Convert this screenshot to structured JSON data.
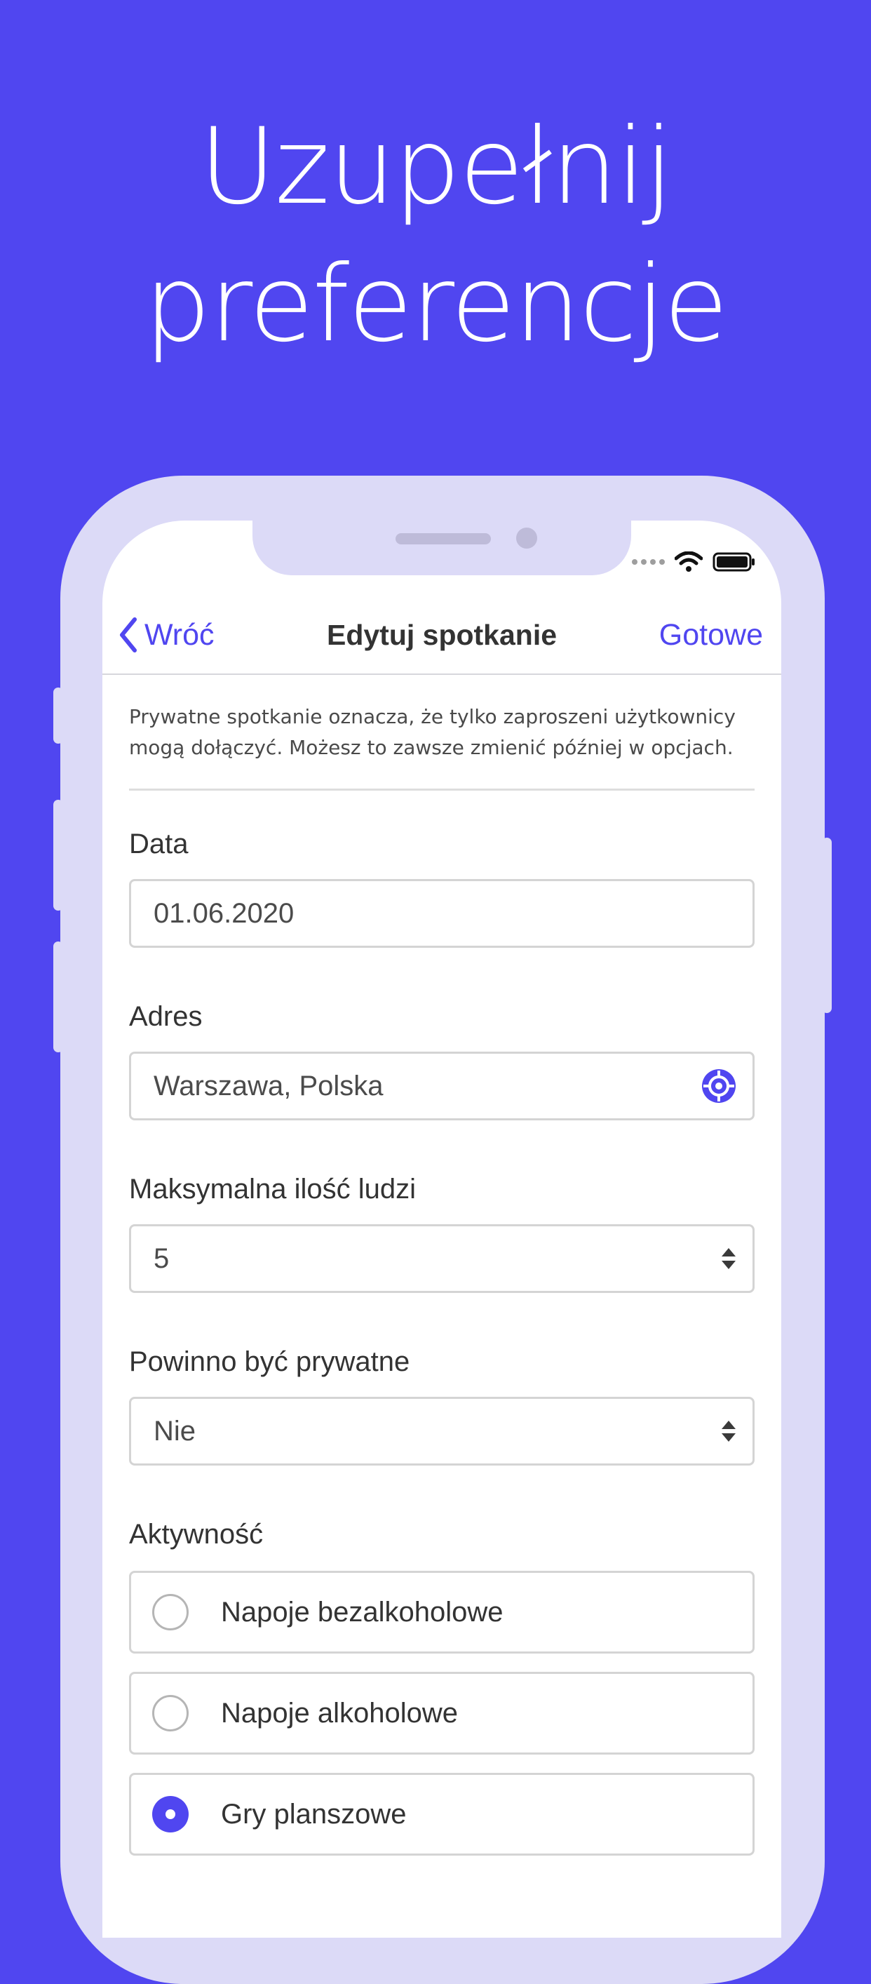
{
  "headline": {
    "line1": "Uzupełnij",
    "line2": "preferencje"
  },
  "colors": {
    "background": "#5046f0",
    "accent": "#5046f0",
    "phone_frame": "#dcdaf7"
  },
  "nav": {
    "back_label": "Wróć",
    "title": "Edytuj spotkanie",
    "done_label": "Gotowe"
  },
  "notice": "Prywatne spotkanie oznacza, że tylko zaproszeni użytkownicy mogą dołączyć. Możesz to zawsze zmienić później w opcjach.",
  "form": {
    "date": {
      "label": "Data",
      "value": "01.06.2020"
    },
    "address": {
      "label": "Adres",
      "value": "Warszawa, Polska",
      "icon": "locate-icon"
    },
    "max_people": {
      "label": "Maksymalna ilość ludzi",
      "value": "5",
      "icon": "select-arrows-icon"
    },
    "private": {
      "label": "Powinno być prywatne",
      "value": "Nie",
      "icon": "select-arrows-icon"
    },
    "activity": {
      "label": "Aktywność",
      "options": [
        {
          "label": "Napoje bezalkoholowe",
          "checked": false
        },
        {
          "label": "Napoje alkoholowe",
          "checked": false
        },
        {
          "label": "Gry planszowe",
          "checked": true
        }
      ]
    }
  }
}
